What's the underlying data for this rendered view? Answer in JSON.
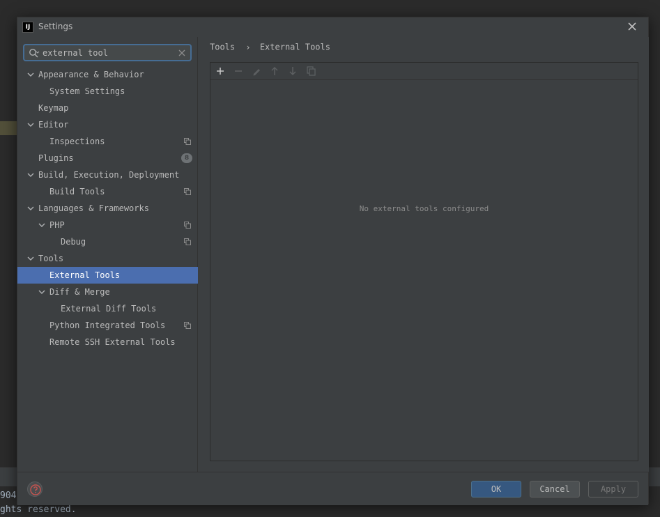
{
  "background": {
    "console_lines": [
      "904",
      "ghts reserved."
    ]
  },
  "dialog": {
    "title": "Settings",
    "app_icon_text": "IJ"
  },
  "search": {
    "value": "external tool",
    "placeholder": ""
  },
  "tree": {
    "items": [
      {
        "label": "Appearance & Behavior",
        "level": 0,
        "expanded": true
      },
      {
        "label": "System Settings",
        "level": 1
      },
      {
        "label": "Keymap",
        "level": 0
      },
      {
        "label": "Editor",
        "level": 0,
        "expanded": true
      },
      {
        "label": "Inspections",
        "level": 1,
        "copy_icon": true
      },
      {
        "label": "Plugins",
        "level": 0,
        "badge": "8"
      },
      {
        "label": "Build, Execution, Deployment",
        "level": 0,
        "expanded": true
      },
      {
        "label": "Build Tools",
        "level": 1,
        "copy_icon": true
      },
      {
        "label": "Languages & Frameworks",
        "level": 0,
        "expanded": true
      },
      {
        "label": "PHP",
        "level": 1,
        "expanded": true,
        "copy_icon": true
      },
      {
        "label": "Debug",
        "level": 2,
        "copy_icon": true
      },
      {
        "label": "Tools",
        "level": 0,
        "expanded": true
      },
      {
        "label": "External Tools",
        "level": 1,
        "selected": true
      },
      {
        "label": "Diff & Merge",
        "level": 1,
        "expanded": true
      },
      {
        "label": "External Diff Tools",
        "level": 2
      },
      {
        "label": "Python Integrated Tools",
        "level": 1,
        "copy_icon": true
      },
      {
        "label": "Remote SSH External Tools",
        "level": 1
      }
    ]
  },
  "breadcrumb": {
    "parent": "Tools",
    "current": "External Tools"
  },
  "toolbar": {
    "buttons": [
      "add-icon",
      "remove-icon",
      "edit-icon",
      "move-up-icon",
      "move-down-icon",
      "copy-icon"
    ]
  },
  "panel": {
    "empty_text": "No external tools configured"
  },
  "footer": {
    "ok_label": "OK",
    "cancel_label": "Cancel",
    "apply_label": "Apply"
  },
  "colors": {
    "selection": "#4b6eaf",
    "dialog_bg": "#3c3f41",
    "focus_border": "#466d94",
    "ok_button": "#365880"
  }
}
